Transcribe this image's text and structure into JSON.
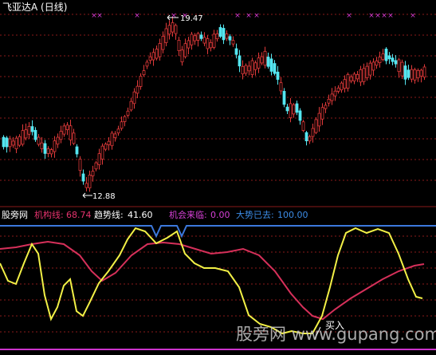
{
  "top_panel": {
    "title": "飞亚达A (日线)",
    "high_label": "19.47",
    "low_label": "12.88",
    "up_color": "#e03a3a",
    "down_color": "#54e6f0",
    "marker_color": "#d63cd6",
    "marker_glyph": "×"
  },
  "bottom_panel": {
    "brand": "股旁网",
    "indicators": [
      {
        "label": "机构线:",
        "value": "68.74",
        "color": "#e6336e"
      },
      {
        "label": "趋势线:",
        "value": "41.60",
        "color": "#ffffff"
      },
      {
        "label": "机会来临:",
        "value": "0.00",
        "color": "#d640d6"
      },
      {
        "label": "大势已去:",
        "value": "100.00",
        "color": "#3c8ce6"
      }
    ],
    "buy_label": "买入",
    "line_colors": {
      "inst": "#d6305a",
      "trend": "#f2f046",
      "top": "#3c78dc",
      "bottom": "#cc33cc"
    }
  },
  "watermark": {
    "text": "股旁网 www.gupang.com"
  }
}
